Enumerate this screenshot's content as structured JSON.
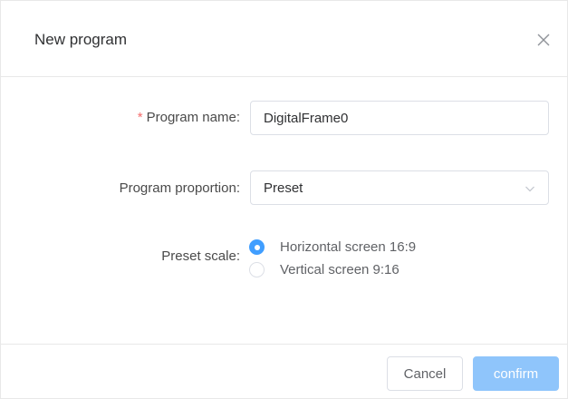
{
  "dialog": {
    "title": "New program"
  },
  "form": {
    "program_name": {
      "required_mark": "*",
      "label": "Program name:",
      "value": "DigitalFrame0"
    },
    "program_proportion": {
      "label": "Program proportion:",
      "selected": "Preset"
    },
    "preset_scale": {
      "label": "Preset scale:",
      "options": [
        {
          "label": "Horizontal screen 16:9",
          "checked": true
        },
        {
          "label": "Vertical screen 9:16",
          "checked": false
        }
      ]
    }
  },
  "buttons": {
    "cancel": "Cancel",
    "confirm": "confirm"
  },
  "colors": {
    "accent": "#409eff",
    "confirm_disabled": "#8fc5fb",
    "required": "#f56c6c"
  },
  "icons": {
    "close": "close-icon",
    "select_arrow": "chevron-down-icon"
  }
}
